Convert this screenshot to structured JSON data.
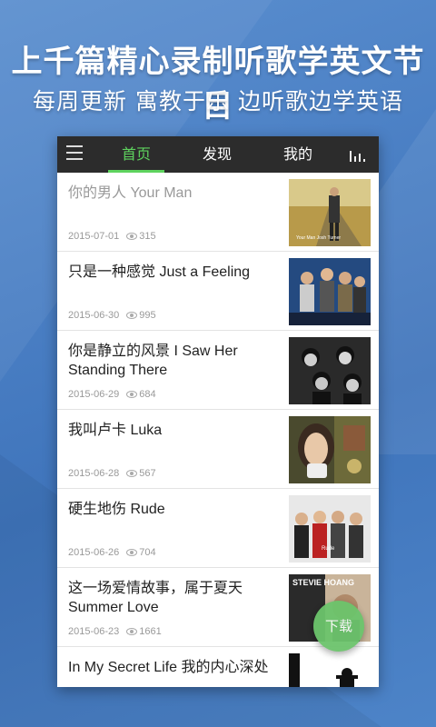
{
  "headline": "上千篇精心录制听歌学英文节目",
  "subheadline": "每周更新  寓教于乐  边听歌边学英语",
  "nav": {
    "tabs": [
      {
        "label": "首页",
        "active": true
      },
      {
        "label": "发现",
        "active": false
      },
      {
        "label": "我的",
        "active": false
      }
    ]
  },
  "items": [
    {
      "title": "你的男人 Your Man",
      "date": "2015-07-01",
      "views": "315",
      "read": true
    },
    {
      "title": "只是一种感觉 Just a Feeling",
      "date": "2015-06-30",
      "views": "995"
    },
    {
      "title": "你是静立的风景 I Saw Her Standing There",
      "date": "2015-06-29",
      "views": "684"
    },
    {
      "title": "我叫卢卡 Luka",
      "date": "2015-06-28",
      "views": "567"
    },
    {
      "title": " 硬生地伤 Rude",
      "date": "2015-06-26",
      "views": "704"
    },
    {
      "title": "这一场爱情故事，属于夏天 Summer Love",
      "date": "2015-06-23",
      "views": "1661"
    },
    {
      "title": "In My Secret Life 我的内心深处",
      "date": "",
      "views": ""
    }
  ],
  "thumb_text": {
    "item0": "Your Man  Josh Turner",
    "item4": "Rude",
    "item5": "STEVIE HOANG"
  },
  "fab_label": "下载",
  "colors": {
    "accent": "#5ed35e",
    "topbar": "#2c2c2c",
    "fab": "#6cc46c"
  },
  "icons": [
    "menu-icon",
    "equalizer-icon",
    "eye-icon"
  ]
}
